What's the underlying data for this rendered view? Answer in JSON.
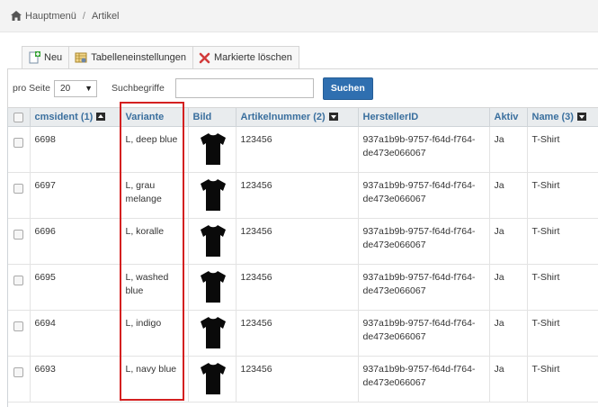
{
  "breadcrumb": {
    "home": "Hauptmenü",
    "separator": "/",
    "current": "Artikel"
  },
  "toolbar": {
    "new_label": "Neu",
    "table_settings_label": "Tabelleneinstellungen",
    "delete_marked_label": "Markierte löschen"
  },
  "filter": {
    "per_page_label": "pro Seite",
    "per_page_value": "20",
    "search_label": "Suchbegriffe",
    "search_value": "",
    "search_button": "Suchen"
  },
  "columns": {
    "cmsident": "cmsident (1)",
    "variante": "Variante",
    "bild": "Bild",
    "artikelnummer": "Artikelnummer (2)",
    "herstellerid": "HerstellerID",
    "aktiv": "Aktiv",
    "name": "Name (3)"
  },
  "rows": [
    {
      "cmsident": "6698",
      "variante": "L, deep blue",
      "artikelnummer": "123456",
      "herstellerid": "937a1b9b-9757-f64d-f764-de473e066067",
      "aktiv": "Ja",
      "name": "T-Shirt"
    },
    {
      "cmsident": "6697",
      "variante": "L, grau melange",
      "artikelnummer": "123456",
      "herstellerid": "937a1b9b-9757-f64d-f764-de473e066067",
      "aktiv": "Ja",
      "name": "T-Shirt"
    },
    {
      "cmsident": "6696",
      "variante": "L, koralle",
      "artikelnummer": "123456",
      "herstellerid": "937a1b9b-9757-f64d-f764-de473e066067",
      "aktiv": "Ja",
      "name": "T-Shirt"
    },
    {
      "cmsident": "6695",
      "variante": "L, washed blue",
      "artikelnummer": "123456",
      "herstellerid": "937a1b9b-9757-f64d-f764-de473e066067",
      "aktiv": "Ja",
      "name": "T-Shirt"
    },
    {
      "cmsident": "6694",
      "variante": "L, indigo",
      "artikelnummer": "123456",
      "herstellerid": "937a1b9b-9757-f64d-f764-de473e066067",
      "aktiv": "Ja",
      "name": "T-Shirt"
    },
    {
      "cmsident": "6693",
      "variante": "L, navy blue",
      "artikelnummer": "123456",
      "herstellerid": "937a1b9b-9757-f64d-f764-de473e066067",
      "aktiv": "Ja",
      "name": "T-Shirt"
    }
  ],
  "colors": {
    "header_text": "#3a6f9e",
    "search_button": "#2f6fb0",
    "highlight": "#d42020"
  },
  "icons": {
    "home": "home-icon",
    "new": "new-document-icon",
    "settings": "table-settings-icon",
    "delete": "delete-x-icon",
    "product": "tshirt-icon"
  }
}
